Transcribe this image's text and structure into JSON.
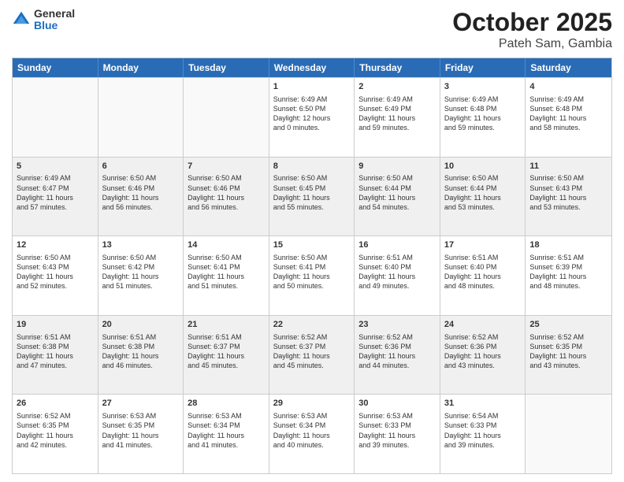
{
  "logo": {
    "general": "General",
    "blue": "Blue"
  },
  "header": {
    "month": "October 2025",
    "location": "Pateh Sam, Gambia"
  },
  "weekdays": [
    "Sunday",
    "Monday",
    "Tuesday",
    "Wednesday",
    "Thursday",
    "Friday",
    "Saturday"
  ],
  "rows": [
    [
      {
        "day": "",
        "text": "",
        "empty": true
      },
      {
        "day": "",
        "text": "",
        "empty": true
      },
      {
        "day": "",
        "text": "",
        "empty": true
      },
      {
        "day": "1",
        "text": "Sunrise: 6:49 AM\nSunset: 6:50 PM\nDaylight: 12 hours\nand 0 minutes."
      },
      {
        "day": "2",
        "text": "Sunrise: 6:49 AM\nSunset: 6:49 PM\nDaylight: 11 hours\nand 59 minutes."
      },
      {
        "day": "3",
        "text": "Sunrise: 6:49 AM\nSunset: 6:48 PM\nDaylight: 11 hours\nand 59 minutes."
      },
      {
        "day": "4",
        "text": "Sunrise: 6:49 AM\nSunset: 6:48 PM\nDaylight: 11 hours\nand 58 minutes."
      }
    ],
    [
      {
        "day": "5",
        "text": "Sunrise: 6:49 AM\nSunset: 6:47 PM\nDaylight: 11 hours\nand 57 minutes."
      },
      {
        "day": "6",
        "text": "Sunrise: 6:50 AM\nSunset: 6:46 PM\nDaylight: 11 hours\nand 56 minutes."
      },
      {
        "day": "7",
        "text": "Sunrise: 6:50 AM\nSunset: 6:46 PM\nDaylight: 11 hours\nand 56 minutes."
      },
      {
        "day": "8",
        "text": "Sunrise: 6:50 AM\nSunset: 6:45 PM\nDaylight: 11 hours\nand 55 minutes."
      },
      {
        "day": "9",
        "text": "Sunrise: 6:50 AM\nSunset: 6:44 PM\nDaylight: 11 hours\nand 54 minutes."
      },
      {
        "day": "10",
        "text": "Sunrise: 6:50 AM\nSunset: 6:44 PM\nDaylight: 11 hours\nand 53 minutes."
      },
      {
        "day": "11",
        "text": "Sunrise: 6:50 AM\nSunset: 6:43 PM\nDaylight: 11 hours\nand 53 minutes."
      }
    ],
    [
      {
        "day": "12",
        "text": "Sunrise: 6:50 AM\nSunset: 6:43 PM\nDaylight: 11 hours\nand 52 minutes."
      },
      {
        "day": "13",
        "text": "Sunrise: 6:50 AM\nSunset: 6:42 PM\nDaylight: 11 hours\nand 51 minutes."
      },
      {
        "day": "14",
        "text": "Sunrise: 6:50 AM\nSunset: 6:41 PM\nDaylight: 11 hours\nand 51 minutes."
      },
      {
        "day": "15",
        "text": "Sunrise: 6:50 AM\nSunset: 6:41 PM\nDaylight: 11 hours\nand 50 minutes."
      },
      {
        "day": "16",
        "text": "Sunrise: 6:51 AM\nSunset: 6:40 PM\nDaylight: 11 hours\nand 49 minutes."
      },
      {
        "day": "17",
        "text": "Sunrise: 6:51 AM\nSunset: 6:40 PM\nDaylight: 11 hours\nand 48 minutes."
      },
      {
        "day": "18",
        "text": "Sunrise: 6:51 AM\nSunset: 6:39 PM\nDaylight: 11 hours\nand 48 minutes."
      }
    ],
    [
      {
        "day": "19",
        "text": "Sunrise: 6:51 AM\nSunset: 6:38 PM\nDaylight: 11 hours\nand 47 minutes."
      },
      {
        "day": "20",
        "text": "Sunrise: 6:51 AM\nSunset: 6:38 PM\nDaylight: 11 hours\nand 46 minutes."
      },
      {
        "day": "21",
        "text": "Sunrise: 6:51 AM\nSunset: 6:37 PM\nDaylight: 11 hours\nand 45 minutes."
      },
      {
        "day": "22",
        "text": "Sunrise: 6:52 AM\nSunset: 6:37 PM\nDaylight: 11 hours\nand 45 minutes."
      },
      {
        "day": "23",
        "text": "Sunrise: 6:52 AM\nSunset: 6:36 PM\nDaylight: 11 hours\nand 44 minutes."
      },
      {
        "day": "24",
        "text": "Sunrise: 6:52 AM\nSunset: 6:36 PM\nDaylight: 11 hours\nand 43 minutes."
      },
      {
        "day": "25",
        "text": "Sunrise: 6:52 AM\nSunset: 6:35 PM\nDaylight: 11 hours\nand 43 minutes."
      }
    ],
    [
      {
        "day": "26",
        "text": "Sunrise: 6:52 AM\nSunset: 6:35 PM\nDaylight: 11 hours\nand 42 minutes."
      },
      {
        "day": "27",
        "text": "Sunrise: 6:53 AM\nSunset: 6:35 PM\nDaylight: 11 hours\nand 41 minutes."
      },
      {
        "day": "28",
        "text": "Sunrise: 6:53 AM\nSunset: 6:34 PM\nDaylight: 11 hours\nand 41 minutes."
      },
      {
        "day": "29",
        "text": "Sunrise: 6:53 AM\nSunset: 6:34 PM\nDaylight: 11 hours\nand 40 minutes."
      },
      {
        "day": "30",
        "text": "Sunrise: 6:53 AM\nSunset: 6:33 PM\nDaylight: 11 hours\nand 39 minutes."
      },
      {
        "day": "31",
        "text": "Sunrise: 6:54 AM\nSunset: 6:33 PM\nDaylight: 11 hours\nand 39 minutes."
      },
      {
        "day": "",
        "text": "",
        "empty": true
      }
    ]
  ]
}
